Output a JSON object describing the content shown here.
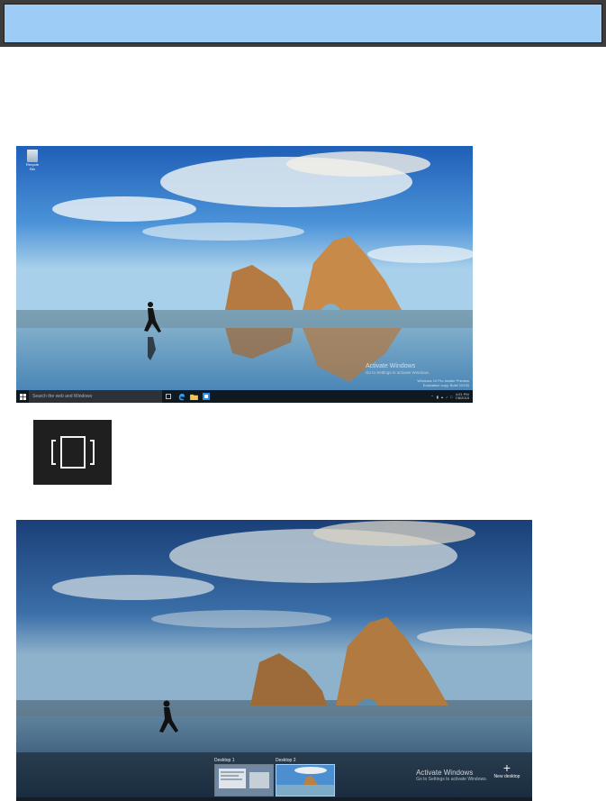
{
  "desktop1": {
    "recycle_bin_label": "Recycle Bin",
    "search_placeholder": "Search the web and Windows",
    "watermark_title": "Activate Windows",
    "watermark_sub": "Go to Settings to activate Windows.",
    "build_line1": "Windows 10 Pro Insider Preview",
    "build_line2": "Evaluation copy. Build 10130",
    "clock_time": "4:01 PM",
    "clock_date": "7/8/2015"
  },
  "desktop2": {
    "desktops": [
      {
        "label": "Desktop 1"
      },
      {
        "label": "Desktop 2"
      }
    ],
    "new_desktop_label": "New desktop",
    "watermark_title": "Activate Windows",
    "watermark_sub": "Go to Settings to activate Windows."
  },
  "icons": {
    "start": "windows-logo-icon",
    "task_view": "task-view-icon",
    "edge": "edge-icon",
    "explorer": "folder-icon",
    "store": "store-icon"
  },
  "colors": {
    "header": "#9dccf7",
    "taskbar": "#101820",
    "accent": "#9fd0ff"
  }
}
